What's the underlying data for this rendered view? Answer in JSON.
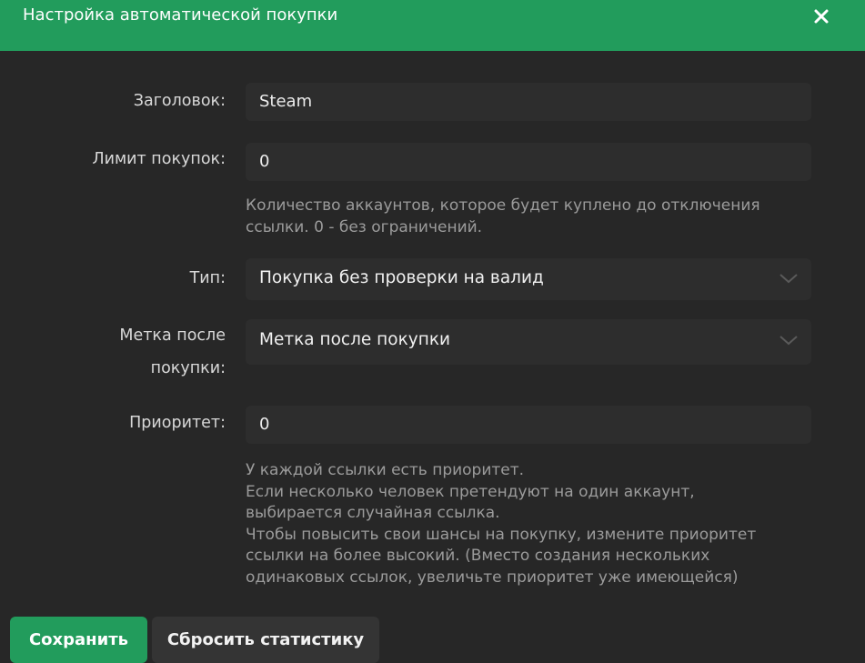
{
  "header": {
    "title": "Настройка автоматической покупки",
    "close_icon": "close-icon"
  },
  "form": {
    "title": {
      "label": "Заголовок:",
      "value": "Steam"
    },
    "purchase_limit": {
      "label": "Лимит покупок:",
      "value": "0",
      "hint_lines": [
        "Количество аккаунтов, которое будет куплено до отключения",
        "ссылки. 0 - без ограничений."
      ]
    },
    "type": {
      "label": "Тип:",
      "value": "Покупка без проверки на валид",
      "icon": "chevron-down-icon"
    },
    "tag_after_purchase": {
      "label_lines": [
        "Метка после",
        "покупки:"
      ],
      "value": "Метка после покупки",
      "icon": "chevron-down-icon"
    },
    "priority": {
      "label": "Приоритет:",
      "value": "0",
      "hint_lines": [
        "У каждой ссылки есть приоритет.",
        "Если несколько человек претендуют на один аккаунт,",
        "выбирается случайная ссылка.",
        "Чтобы повысить свои шансы на покупку, измените приоритет",
        "ссылки на более высокий. (Вместо создания нескольких",
        "одинаковых ссылок, увеличьте приоритет уже имеющейся)"
      ]
    }
  },
  "buttons": {
    "save_label": "Сохранить",
    "reset_label": "Сбросить статистику"
  },
  "colors": {
    "accent": "#229c5c",
    "background": "#272727",
    "field": "#2d2d2d",
    "hint_text": "#9b9b9b"
  }
}
